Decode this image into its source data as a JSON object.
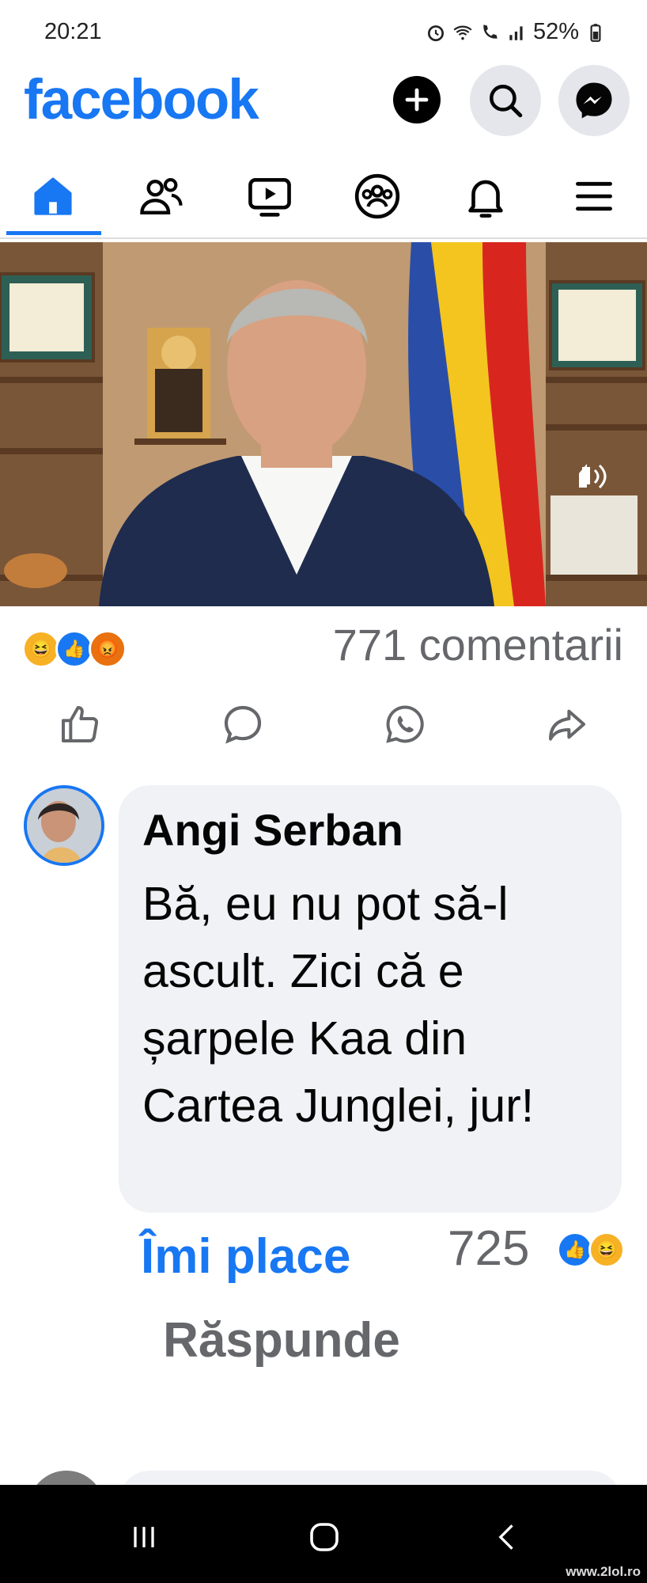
{
  "status_bar": {
    "time": "20:21",
    "battery": "52%",
    "icons": [
      "alarm-icon",
      "wifi-icon",
      "wifi-call-icon",
      "signal-icon",
      "battery-icon"
    ]
  },
  "header": {
    "logo": "facebook",
    "buttons": [
      "plus-icon",
      "search-icon",
      "messenger-icon"
    ]
  },
  "tabs": [
    {
      "name": "home",
      "icon": "home-icon",
      "active": true
    },
    {
      "name": "friends",
      "icon": "friends-icon",
      "active": false
    },
    {
      "name": "video",
      "icon": "video-icon",
      "active": false
    },
    {
      "name": "groups",
      "icon": "groups-icon",
      "active": false
    },
    {
      "name": "notifications",
      "icon": "bell-icon",
      "active": false
    },
    {
      "name": "menu",
      "icon": "menu-icon",
      "active": false
    }
  ],
  "post": {
    "reactions": [
      "haha",
      "like",
      "angry"
    ],
    "comment_count": "771 comentarii",
    "actions": [
      "like-icon",
      "comment-icon",
      "whatsapp-icon",
      "share-icon"
    ]
  },
  "comment": {
    "author": "Angi Serban",
    "text": "Bă, eu nu pot să-l ascult. Zici că e șarpele Kaa din Cartea Junglei, jur!",
    "like_label": "Îmi place",
    "reply_label": "Răspunde",
    "like_count": "725",
    "reactions": [
      "like",
      "haha"
    ]
  },
  "colors": {
    "brand": "#1877f2",
    "secondary_text": "#65676b",
    "bubble": "#f0f2f5"
  },
  "watermark": "www.2lol.ro"
}
